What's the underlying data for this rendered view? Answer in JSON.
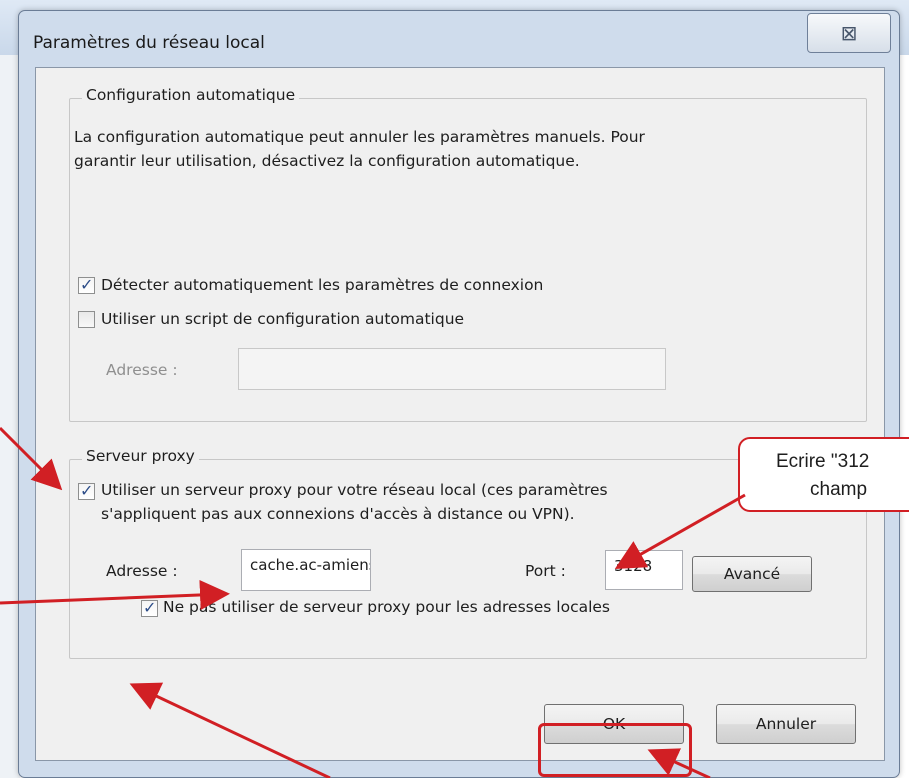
{
  "dialog": {
    "title": "Paramètres du réseau local",
    "close_symbol": "⊠"
  },
  "auto_config": {
    "group_title": "Configuration automatique",
    "description_line1": "La configuration automatique peut annuler les paramètres manuels. Pour",
    "description_line2": "garantir leur utilisation, désactivez la configuration automatique.",
    "detect_label": "Détecter automatiquement les paramètres de connexion",
    "detect_checked": true,
    "script_label": "Utiliser un script de configuration automatique",
    "script_checked": false,
    "address_label": "Adresse :",
    "address_value": ""
  },
  "proxy": {
    "group_title": "Serveur proxy",
    "use_proxy_line1": "Utiliser un serveur proxy pour votre réseau local (ces paramètres",
    "use_proxy_line2": "s'appliquent pas aux connexions d'accès à distance ou VPN).",
    "use_proxy_checked": true,
    "address_label": "Adresse :",
    "address_value": "cache.ac-amiens",
    "port_label": "Port :",
    "port_value": "3128",
    "advanced_label": "Avancé",
    "bypass_label": "Ne pas utiliser de serveur proxy pour les adresses locales",
    "bypass_checked": true
  },
  "buttons": {
    "ok": "OK",
    "cancel": "Annuler"
  },
  "annotation": {
    "callout_line1": "Ecrire \"312",
    "callout_line2": "champ",
    "accent_color": "#d11f24"
  }
}
